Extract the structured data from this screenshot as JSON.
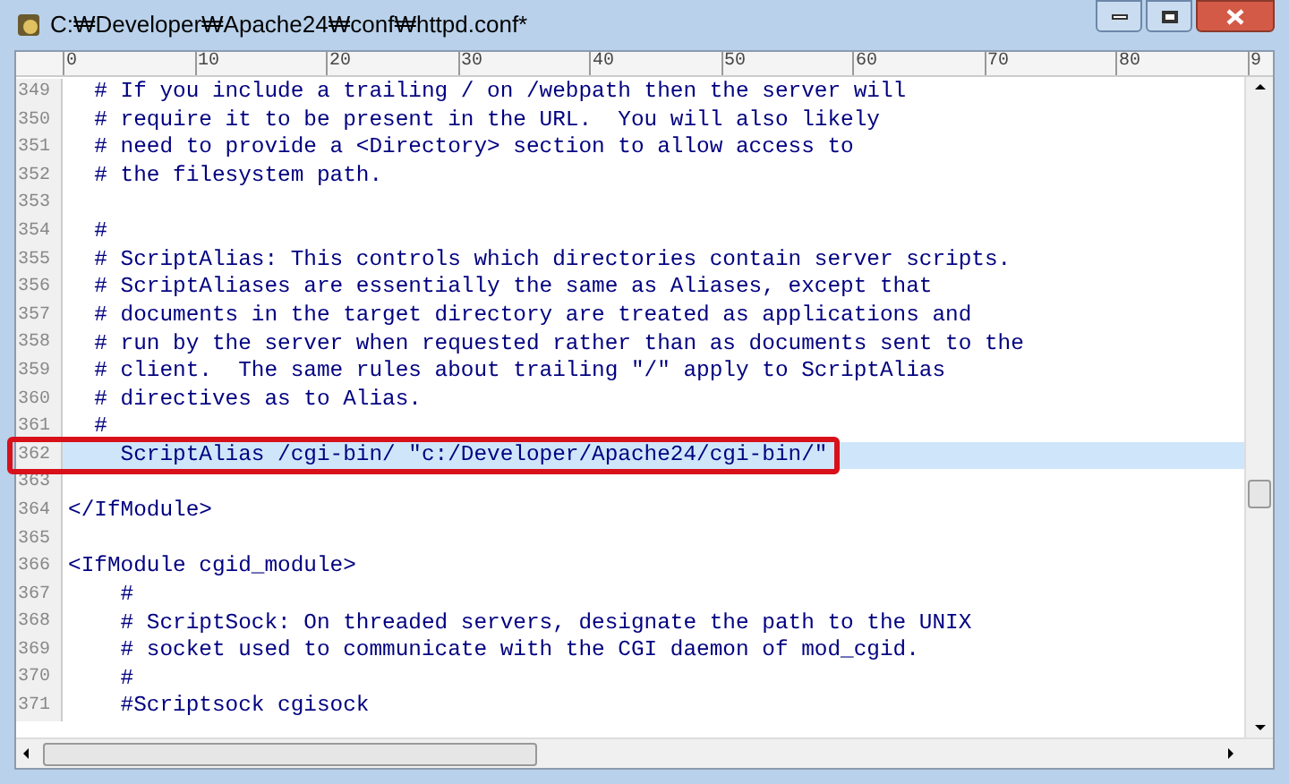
{
  "window": {
    "title": "C:₩Developer₩Apache24₩conf₩httpd.conf*"
  },
  "ruler": {
    "labels": [
      "0",
      "10",
      "20",
      "30",
      "40",
      "50",
      "60",
      "70",
      "80",
      "9"
    ]
  },
  "lines": [
    {
      "number": "349",
      "text": "  # If you include a trailing / on /webpath then the server will",
      "selected": false
    },
    {
      "number": "350",
      "text": "  # require it to be present in the URL.  You will also likely",
      "selected": false
    },
    {
      "number": "351",
      "text": "  # need to provide a <Directory> section to allow access to",
      "selected": false
    },
    {
      "number": "352",
      "text": "  # the filesystem path.",
      "selected": false
    },
    {
      "number": "353",
      "selected": false
    },
    {
      "number": "354",
      "text": "  #",
      "selected": false
    },
    {
      "number": "355",
      "text": "  # ScriptAlias: This controls which directories contain server scripts.",
      "selected": false
    },
    {
      "number": "356",
      "text": "  # ScriptAliases are essentially the same as Aliases, except that",
      "selected": false
    },
    {
      "number": "357",
      "text": "  # documents in the target directory are treated as applications and",
      "selected": false
    },
    {
      "number": "358",
      "text": "  # run by the server when requested rather than as documents sent to the",
      "selected": false
    },
    {
      "number": "359",
      "text": "  # client.  The same rules about trailing \"/\" apply to ScriptAlias",
      "selected": false
    },
    {
      "number": "360",
      "text": "  # directives as to Alias.",
      "selected": false
    },
    {
      "number": "361",
      "text": "  #",
      "selected": false
    },
    {
      "number": "362",
      "text": "    ScriptAlias /cgi-bin/ \"c:/Developer/Apache24/cgi-bin/\"",
      "selected": true
    },
    {
      "number": "363",
      "selected": false
    },
    {
      "number": "364",
      "text": "</IfModule>",
      "selected": false
    },
    {
      "number": "365",
      "selected": false
    },
    {
      "number": "366",
      "text": "<IfModule cgid_module>",
      "selected": false
    },
    {
      "number": "367",
      "text": "    #",
      "selected": false
    },
    {
      "number": "368",
      "text": "    # ScriptSock: On threaded servers, designate the path to the UNIX",
      "selected": false
    },
    {
      "number": "369",
      "text": "    # socket used to communicate with the CGI daemon of mod_cgid.",
      "selected": false
    },
    {
      "number": "370",
      "text": "    #",
      "selected": false
    },
    {
      "number": "371",
      "text": "    #Scriptsock cgisock",
      "selected": false
    }
  ]
}
